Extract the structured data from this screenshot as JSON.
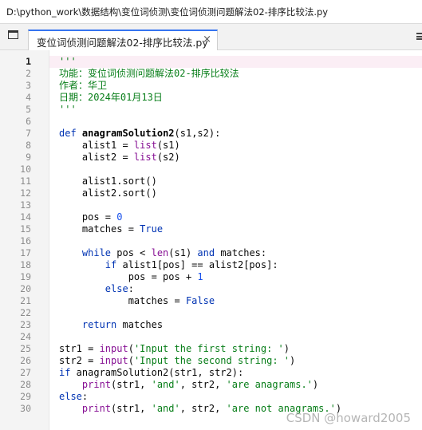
{
  "window": {
    "path": "D:\\python_work\\数据结构\\变位词侦测\\变位词侦测问题解法02-排序比较法.py"
  },
  "tab": {
    "title": "变位词侦测问题解法02-排序比较法.py",
    "close": "×"
  },
  "editor": {
    "active_line": 1,
    "line_numbers": [
      "1",
      "2",
      "3",
      "4",
      "5",
      "6",
      "7",
      "8",
      "9",
      "10",
      "11",
      "12",
      "13",
      "14",
      "15",
      "16",
      "17",
      "18",
      "19",
      "20",
      "21",
      "22",
      "23",
      "24",
      "25",
      "26",
      "27",
      "28",
      "29",
      "30"
    ],
    "lines": [
      "'''",
      "功能：变位词侦测问题解法02-排序比较法",
      "作者：华卫",
      "日期：2024年01月13日",
      "'''",
      "",
      "def anagramSolution2(s1,s2):",
      "    alist1 = list(s1)",
      "    alist2 = list(s2)",
      "",
      "    alist1.sort()",
      "    alist2.sort()",
      "",
      "    pos = 0",
      "    matches = True",
      "",
      "    while pos < len(s1) and matches:",
      "        if alist1[pos] == alist2[pos]:",
      "            pos = pos + 1",
      "        else:",
      "            matches = False",
      "",
      "    return matches",
      "",
      "str1 = input('Input the first string: ')",
      "str2 = input('Input the second string: ')",
      "if anagramSolution2(str1, str2):",
      "    print(str1, 'and', str2, 'are anagrams.')",
      "else:",
      "    print(str1, 'and', str2, 'are not anagrams.')"
    ]
  },
  "watermark": "CSDN @howard2005"
}
